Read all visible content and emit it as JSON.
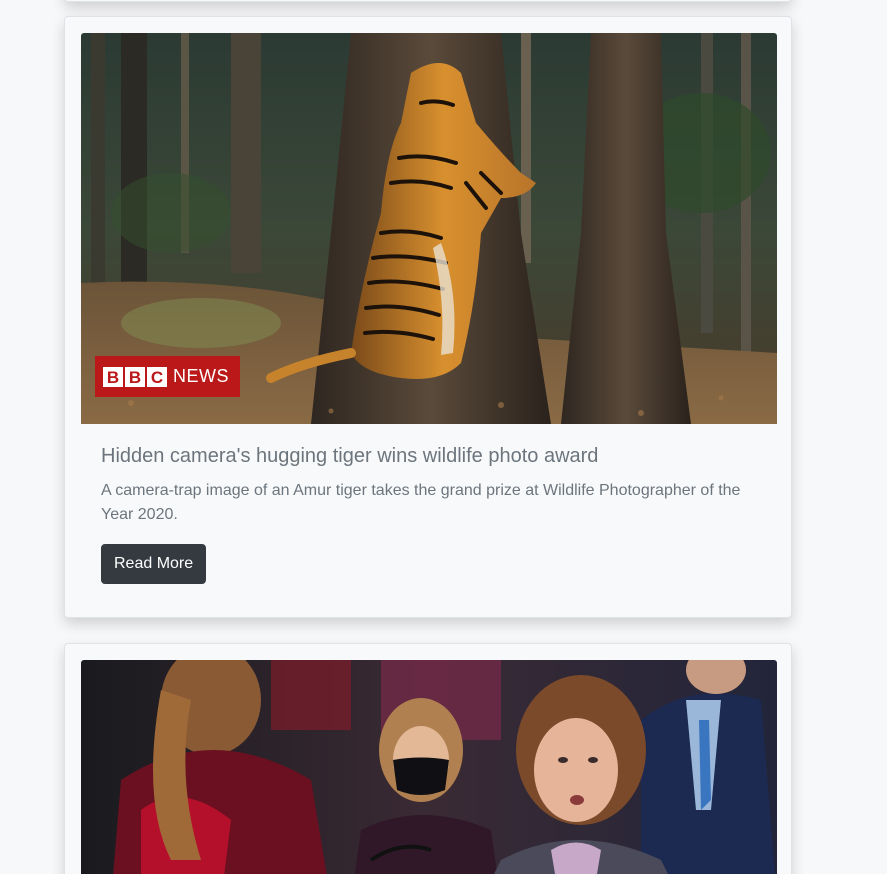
{
  "colors": {
    "page_bg": "#f7f8fa",
    "card_bg": "#f8f9fa",
    "button_bg": "#343a40",
    "text_muted": "#6c757d",
    "bbc_red": "#bb1919"
  },
  "articles": [
    {
      "image_badge": {
        "letters": [
          "B",
          "B",
          "C"
        ],
        "word": "NEWS"
      },
      "title": "Hidden camera's hugging tiger wins wildlife photo award",
      "description": "A camera-trap image of an Amur tiger takes the grand prize at Wildlife Photographer of the Year 2020.",
      "button_label": "Read More"
    }
  ]
}
